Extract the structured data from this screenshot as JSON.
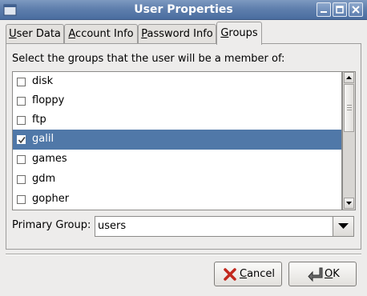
{
  "window": {
    "title": "User Properties",
    "controls": [
      "minimize-icon",
      "maximize-icon",
      "close-icon"
    ]
  },
  "tabs": [
    {
      "label_mnemonic": "U",
      "label_rest": "ser Data",
      "active": false
    },
    {
      "label_mnemonic": "A",
      "label_rest": "ccount Info",
      "active": false
    },
    {
      "label_mnemonic": "P",
      "label_rest": "assword Info",
      "active": false
    },
    {
      "label_mnemonic": "G",
      "label_rest": "roups",
      "active": true
    }
  ],
  "groups": {
    "instruction": "Select the groups that the user will be a member of:",
    "items": [
      {
        "name": "disk",
        "checked": false,
        "selected": false
      },
      {
        "name": "floppy",
        "checked": false,
        "selected": false
      },
      {
        "name": "ftp",
        "checked": false,
        "selected": false
      },
      {
        "name": "galil",
        "checked": true,
        "selected": true
      },
      {
        "name": "games",
        "checked": false,
        "selected": false
      },
      {
        "name": "gdm",
        "checked": false,
        "selected": false
      },
      {
        "name": "gopher",
        "checked": false,
        "selected": false
      }
    ]
  },
  "primary_group": {
    "label": "Primary Group:",
    "value": "users"
  },
  "buttons": {
    "cancel": {
      "mnemonic": "C",
      "rest": "ancel",
      "icon": "cancel-x-icon"
    },
    "ok": {
      "mnemonic": "O",
      "rest": "K",
      "icon": "ok-arrow-icon"
    }
  },
  "colors": {
    "titlebar": "#5f7fad",
    "selection": "#5078a8",
    "window_bg": "#edeceb"
  }
}
